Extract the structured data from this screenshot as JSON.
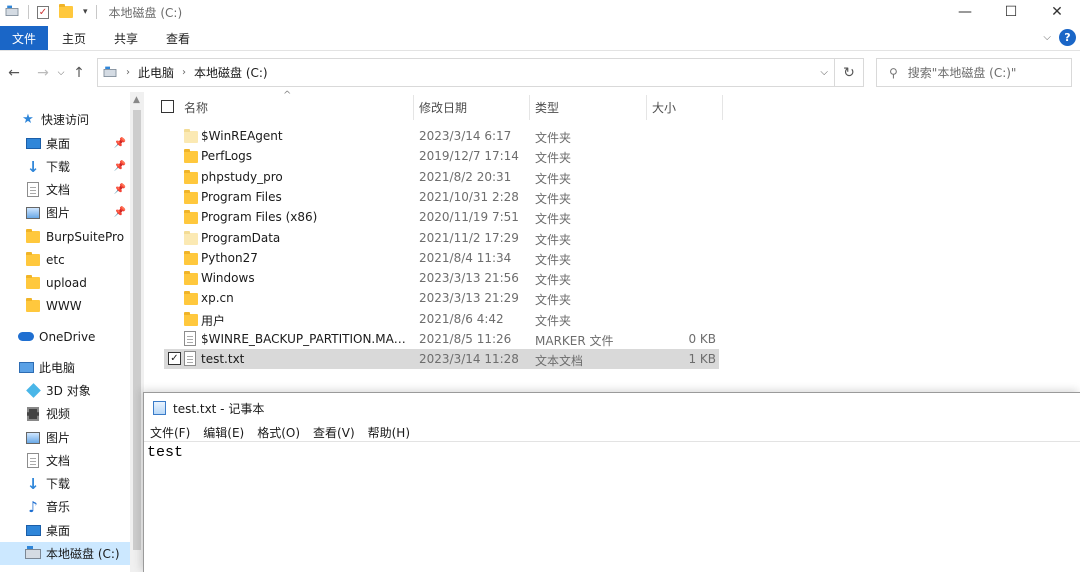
{
  "window": {
    "title": "本地磁盘 (C:)",
    "controls": {
      "minimize": "—",
      "maximize": "☐",
      "close": "✕"
    }
  },
  "ribbon": {
    "tabs": [
      "文件",
      "主页",
      "共享",
      "查看"
    ],
    "help_label": "?"
  },
  "address": {
    "breadcrumbs": [
      "此电脑",
      "本地磁盘 (C:)"
    ],
    "search_placeholder": "搜索\"本地磁盘 (C:)\""
  },
  "nav": {
    "quick_access": "快速访问",
    "quick_items": [
      {
        "label": "桌面",
        "icon": "desktop-icon",
        "pinned": true
      },
      {
        "label": "下载",
        "icon": "download-icon",
        "pinned": true
      },
      {
        "label": "文档",
        "icon": "document-icon",
        "pinned": true
      },
      {
        "label": "图片",
        "icon": "picture-icon",
        "pinned": true
      },
      {
        "label": "BurpSuitePro",
        "icon": "folder-icon",
        "pinned": false
      },
      {
        "label": "etc",
        "icon": "folder-icon",
        "pinned": false
      },
      {
        "label": "upload",
        "icon": "folder-icon",
        "pinned": false
      },
      {
        "label": "WWW",
        "icon": "folder-icon",
        "pinned": false
      }
    ],
    "onedrive": "OneDrive",
    "this_pc": "此电脑",
    "pc_items": [
      {
        "label": "3D 对象",
        "icon": "3d-objects-icon"
      },
      {
        "label": "视频",
        "icon": "video-icon"
      },
      {
        "label": "图片",
        "icon": "picture-icon"
      },
      {
        "label": "文档",
        "icon": "document-icon"
      },
      {
        "label": "下载",
        "icon": "download-icon"
      },
      {
        "label": "音乐",
        "icon": "music-icon"
      },
      {
        "label": "桌面",
        "icon": "desktop-icon"
      },
      {
        "label": "本地磁盘 (C:)",
        "icon": "drive-icon",
        "selected": true
      }
    ]
  },
  "columns": {
    "name": "名称",
    "date": "修改日期",
    "type": "类型",
    "size": "大小"
  },
  "files": [
    {
      "name": "$WinREAgent",
      "date": "2023/3/14 6:17",
      "type": "文件夹",
      "size": "",
      "kind": "folder-light"
    },
    {
      "name": "PerfLogs",
      "date": "2019/12/7 17:14",
      "type": "文件夹",
      "size": "",
      "kind": "folder"
    },
    {
      "name": "phpstudy_pro",
      "date": "2021/8/2 20:31",
      "type": "文件夹",
      "size": "",
      "kind": "folder"
    },
    {
      "name": "Program Files",
      "date": "2021/10/31 2:28",
      "type": "文件夹",
      "size": "",
      "kind": "folder"
    },
    {
      "name": "Program Files (x86)",
      "date": "2020/11/19 7:51",
      "type": "文件夹",
      "size": "",
      "kind": "folder"
    },
    {
      "name": "ProgramData",
      "date": "2021/11/2 17:29",
      "type": "文件夹",
      "size": "",
      "kind": "folder-light"
    },
    {
      "name": "Python27",
      "date": "2021/8/4 11:34",
      "type": "文件夹",
      "size": "",
      "kind": "folder"
    },
    {
      "name": "Windows",
      "date": "2023/3/13 21:56",
      "type": "文件夹",
      "size": "",
      "kind": "folder"
    },
    {
      "name": "xp.cn",
      "date": "2023/3/13 21:29",
      "type": "文件夹",
      "size": "",
      "kind": "folder"
    },
    {
      "name": "用户",
      "date": "2021/8/6 4:42",
      "type": "文件夹",
      "size": "",
      "kind": "folder"
    },
    {
      "name": "$WINRE_BACKUP_PARTITION.MARKER",
      "date": "2021/8/5 11:26",
      "type": "MARKER 文件",
      "size": "0 KB",
      "kind": "file"
    },
    {
      "name": "test.txt",
      "date": "2023/3/14 11:28",
      "type": "文本文档",
      "size": "1 KB",
      "kind": "file",
      "selected": true
    }
  ],
  "notepad": {
    "title": "test.txt - 记事本",
    "menu": [
      "文件(F)",
      "编辑(E)",
      "格式(O)",
      "查看(V)",
      "帮助(H)"
    ],
    "content": "test"
  }
}
